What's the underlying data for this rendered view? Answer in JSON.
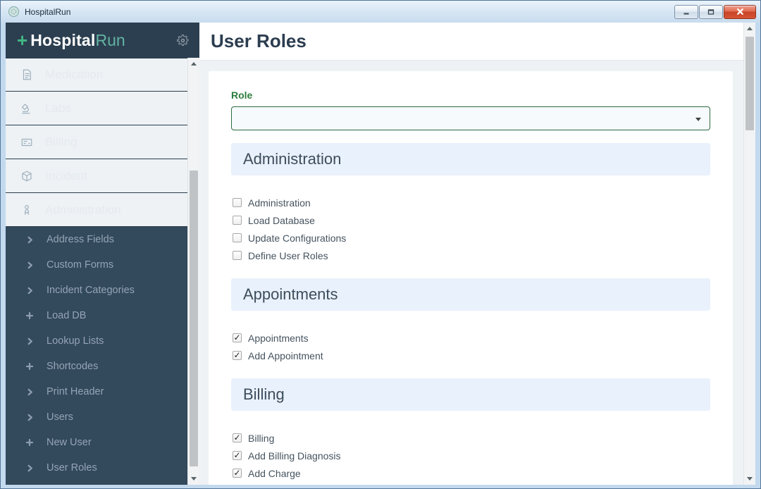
{
  "window": {
    "title": "HospitalRun"
  },
  "sidebar": {
    "logo": {
      "plus_glyph": "+",
      "part1": "Hospital",
      "part2": "Run",
      "settings_icon": "gear-icon"
    },
    "items": [
      {
        "label": "Medication",
        "icon": "document-icon",
        "type": "main"
      },
      {
        "label": "Labs",
        "icon": "microscope-icon",
        "type": "main"
      },
      {
        "label": "Billing",
        "icon": "billing-icon",
        "type": "main"
      },
      {
        "label": "Incident",
        "icon": "cube-icon",
        "type": "main"
      },
      {
        "label": "Administration",
        "icon": "person-icon",
        "type": "main"
      },
      {
        "label": "Address Fields",
        "icon": "chevron-right-icon",
        "type": "sub"
      },
      {
        "label": "Custom Forms",
        "icon": "chevron-right-icon",
        "type": "sub"
      },
      {
        "label": "Incident Categories",
        "icon": "chevron-right-icon",
        "type": "sub"
      },
      {
        "label": "Load DB",
        "icon": "plus-icon",
        "type": "sub"
      },
      {
        "label": "Lookup Lists",
        "icon": "chevron-right-icon",
        "type": "sub"
      },
      {
        "label": "Shortcodes",
        "icon": "plus-icon",
        "type": "sub"
      },
      {
        "label": "Print Header",
        "icon": "chevron-right-icon",
        "type": "sub"
      },
      {
        "label": "Users",
        "icon": "chevron-right-icon",
        "type": "sub"
      },
      {
        "label": "New User",
        "icon": "plus-icon",
        "type": "sub"
      },
      {
        "label": "User Roles",
        "icon": "chevron-right-icon",
        "type": "sub"
      }
    ]
  },
  "main": {
    "title": "User Roles",
    "role_field": {
      "label": "Role",
      "value": ""
    },
    "sections": [
      {
        "title": "Administration",
        "permissions": [
          {
            "label": "Administration",
            "checked": false
          },
          {
            "label": "Load Database",
            "checked": false
          },
          {
            "label": "Update Configurations",
            "checked": false
          },
          {
            "label": "Define User Roles",
            "checked": false
          }
        ]
      },
      {
        "title": "Appointments",
        "permissions": [
          {
            "label": "Appointments",
            "checked": true
          },
          {
            "label": "Add Appointment",
            "checked": true
          }
        ]
      },
      {
        "title": "Billing",
        "permissions": [
          {
            "label": "Billing",
            "checked": true
          },
          {
            "label": "Add Billing Diagnosis",
            "checked": true
          },
          {
            "label": "Add Charge",
            "checked": true
          }
        ]
      }
    ]
  },
  "colors": {
    "accent_green": "#42b883",
    "logo_run_teal": "#63b3a2",
    "sidebar_bg": "#33495c",
    "sidebar_header_bg": "#2c3f50",
    "section_header_bg": "#e9f1fc",
    "role_label_green": "#2e7d3e",
    "select_border_green": "#2d6b40",
    "title_navy": "#2c3d50",
    "titlebar_blue": "#d7e6f4",
    "close_button_red": "#c94427"
  },
  "checkmark_glyph": "✓"
}
